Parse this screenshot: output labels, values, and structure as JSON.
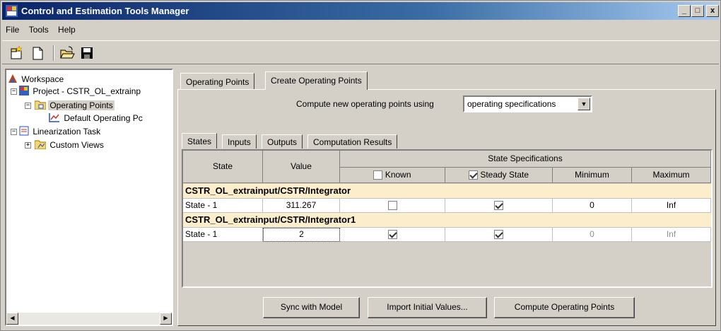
{
  "window": {
    "title": "Control and Estimation Tools Manager",
    "controls": {
      "minimize": "_",
      "maximize": "□",
      "close": "x"
    }
  },
  "menu": [
    "File",
    "Tools",
    "Help"
  ],
  "toolbar": {
    "icons": [
      "new-project-icon",
      "new-file-icon",
      "open-folder-icon",
      "save-icon"
    ]
  },
  "tree": {
    "workspace": "Workspace",
    "project": "Project - CSTR_OL_extrainp",
    "operating_points": "Operating Points",
    "default_op": "Default Operating Pc",
    "linearization": "Linearization Task",
    "custom_views": "Custom Views"
  },
  "main": {
    "tabs": [
      "Operating Points",
      "Create Operating Points"
    ],
    "compute_label": "Compute new operating points using",
    "compute_select": "operating specifications",
    "subtabs": [
      "States",
      "Inputs",
      "Outputs",
      "Computation Results"
    ],
    "table": {
      "col_state": "State",
      "col_value": "Value",
      "col_group": "State Specifications",
      "col_known": "Known",
      "col_steady": "Steady State",
      "col_min": "Minimum",
      "col_max": "Maximum",
      "groups": [
        {
          "name": "CSTR_OL_extrainput/CSTR/Integrator",
          "row": {
            "state": "State - 1",
            "value": "311.267",
            "known": false,
            "steady": true,
            "min": "0",
            "max": "Inf"
          }
        },
        {
          "name": "CSTR_OL_extrainput/CSTR/Integrator1",
          "row": {
            "state": "State - 1",
            "value": "2",
            "known": true,
            "steady": true,
            "min": "0",
            "max": "Inf"
          }
        }
      ]
    },
    "buttons": {
      "sync": "Sync with Model",
      "import": "Import Initial Values...",
      "compute": "Compute Operating Points"
    }
  },
  "colors": {
    "title_bar": "#0a246a",
    "group_row": "#fdeecb",
    "face": "#d4d0c8"
  }
}
